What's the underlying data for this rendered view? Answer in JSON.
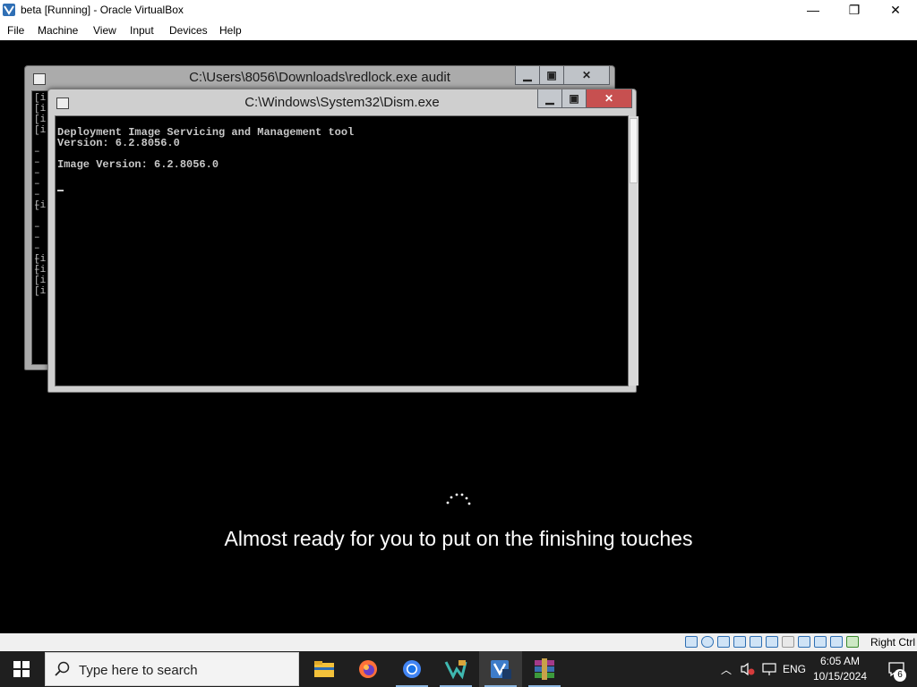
{
  "host_window": {
    "title": "beta [Running] - Oracle VirtualBox",
    "menu": [
      "File",
      "Machine",
      "View",
      "Input",
      "Devices",
      "Help"
    ],
    "controls": {
      "minimize": "—",
      "maximize": "❐",
      "close": "✕"
    }
  },
  "guest": {
    "back_window": {
      "title": "C:\\Users\\8056\\Downloads\\redlock.exe audit",
      "visible_lines": [
        "[i",
        "[i",
        "[i",
        "[i",
        "–",
        "–",
        "–",
        "–",
        "–",
        "–",
        "[i",
        "–",
        "–",
        "–",
        "–",
        "–",
        "[i",
        "[i",
        "[i",
        "[i"
      ]
    },
    "front_window": {
      "title": "C:\\Windows\\System32\\Dism.exe",
      "console_lines": [
        "Deployment Image Servicing and Management tool",
        "Version: 6.2.8056.0",
        "",
        "Image Version: 6.2.8056.0"
      ]
    },
    "oobe_message": "Almost ready for you to put on the finishing touches"
  },
  "vbox_statusbar": {
    "host_key": "Right Ctrl"
  },
  "taskbar": {
    "search_placeholder": "Type here to search",
    "apps": [
      "file-explorer",
      "firefox",
      "chrome",
      "visual-studio",
      "virtualbox",
      "winrar"
    ],
    "language": "ENG",
    "time": "6:05 AM",
    "date": "10/15/2024",
    "notification_count": "6"
  },
  "colors": {
    "taskbar": "#1f1f1f",
    "close_button_red": "#c75050",
    "console_text": "#c8c8c8"
  }
}
